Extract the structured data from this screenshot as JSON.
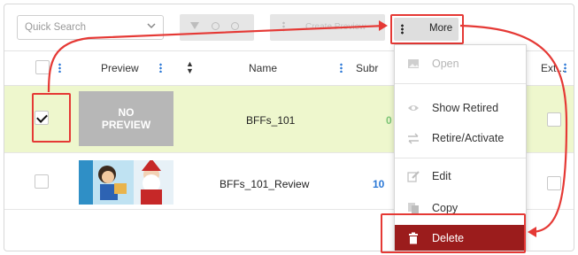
{
  "toolbar": {
    "search_placeholder": "Quick Search",
    "create_label": "Create Preview",
    "more_label": "More"
  },
  "table": {
    "columns": [
      "Preview",
      "Name",
      "Subr",
      "Ext..."
    ],
    "rows": [
      {
        "selected": true,
        "preview": "NO PREVIEW",
        "name": "BFFs_101",
        "subr": "0"
      },
      {
        "selected": false,
        "preview": "",
        "name": "BFFs_101_Review",
        "subr": "10"
      }
    ]
  },
  "menu": {
    "items": [
      {
        "label": "Open",
        "icon": "image-icon",
        "enabled": false
      },
      {
        "label": "Show Retired",
        "icon": "eye-icon",
        "enabled": true
      },
      {
        "label": "Retire/Activate",
        "icon": "swap-arrows-icon",
        "enabled": true
      },
      {
        "label": "Edit",
        "icon": "edit-icon",
        "enabled": true
      },
      {
        "label": "Copy",
        "icon": "copy-icon",
        "enabled": true
      },
      {
        "label": "Delete",
        "icon": "trash-icon",
        "enabled": true
      }
    ]
  },
  "colors": {
    "highlight": "#e53935",
    "selected_row": "#eef7cd",
    "delete_bg": "#9b1c1c",
    "link_blue": "#2b78d6",
    "subr_green": "#7cc576"
  }
}
